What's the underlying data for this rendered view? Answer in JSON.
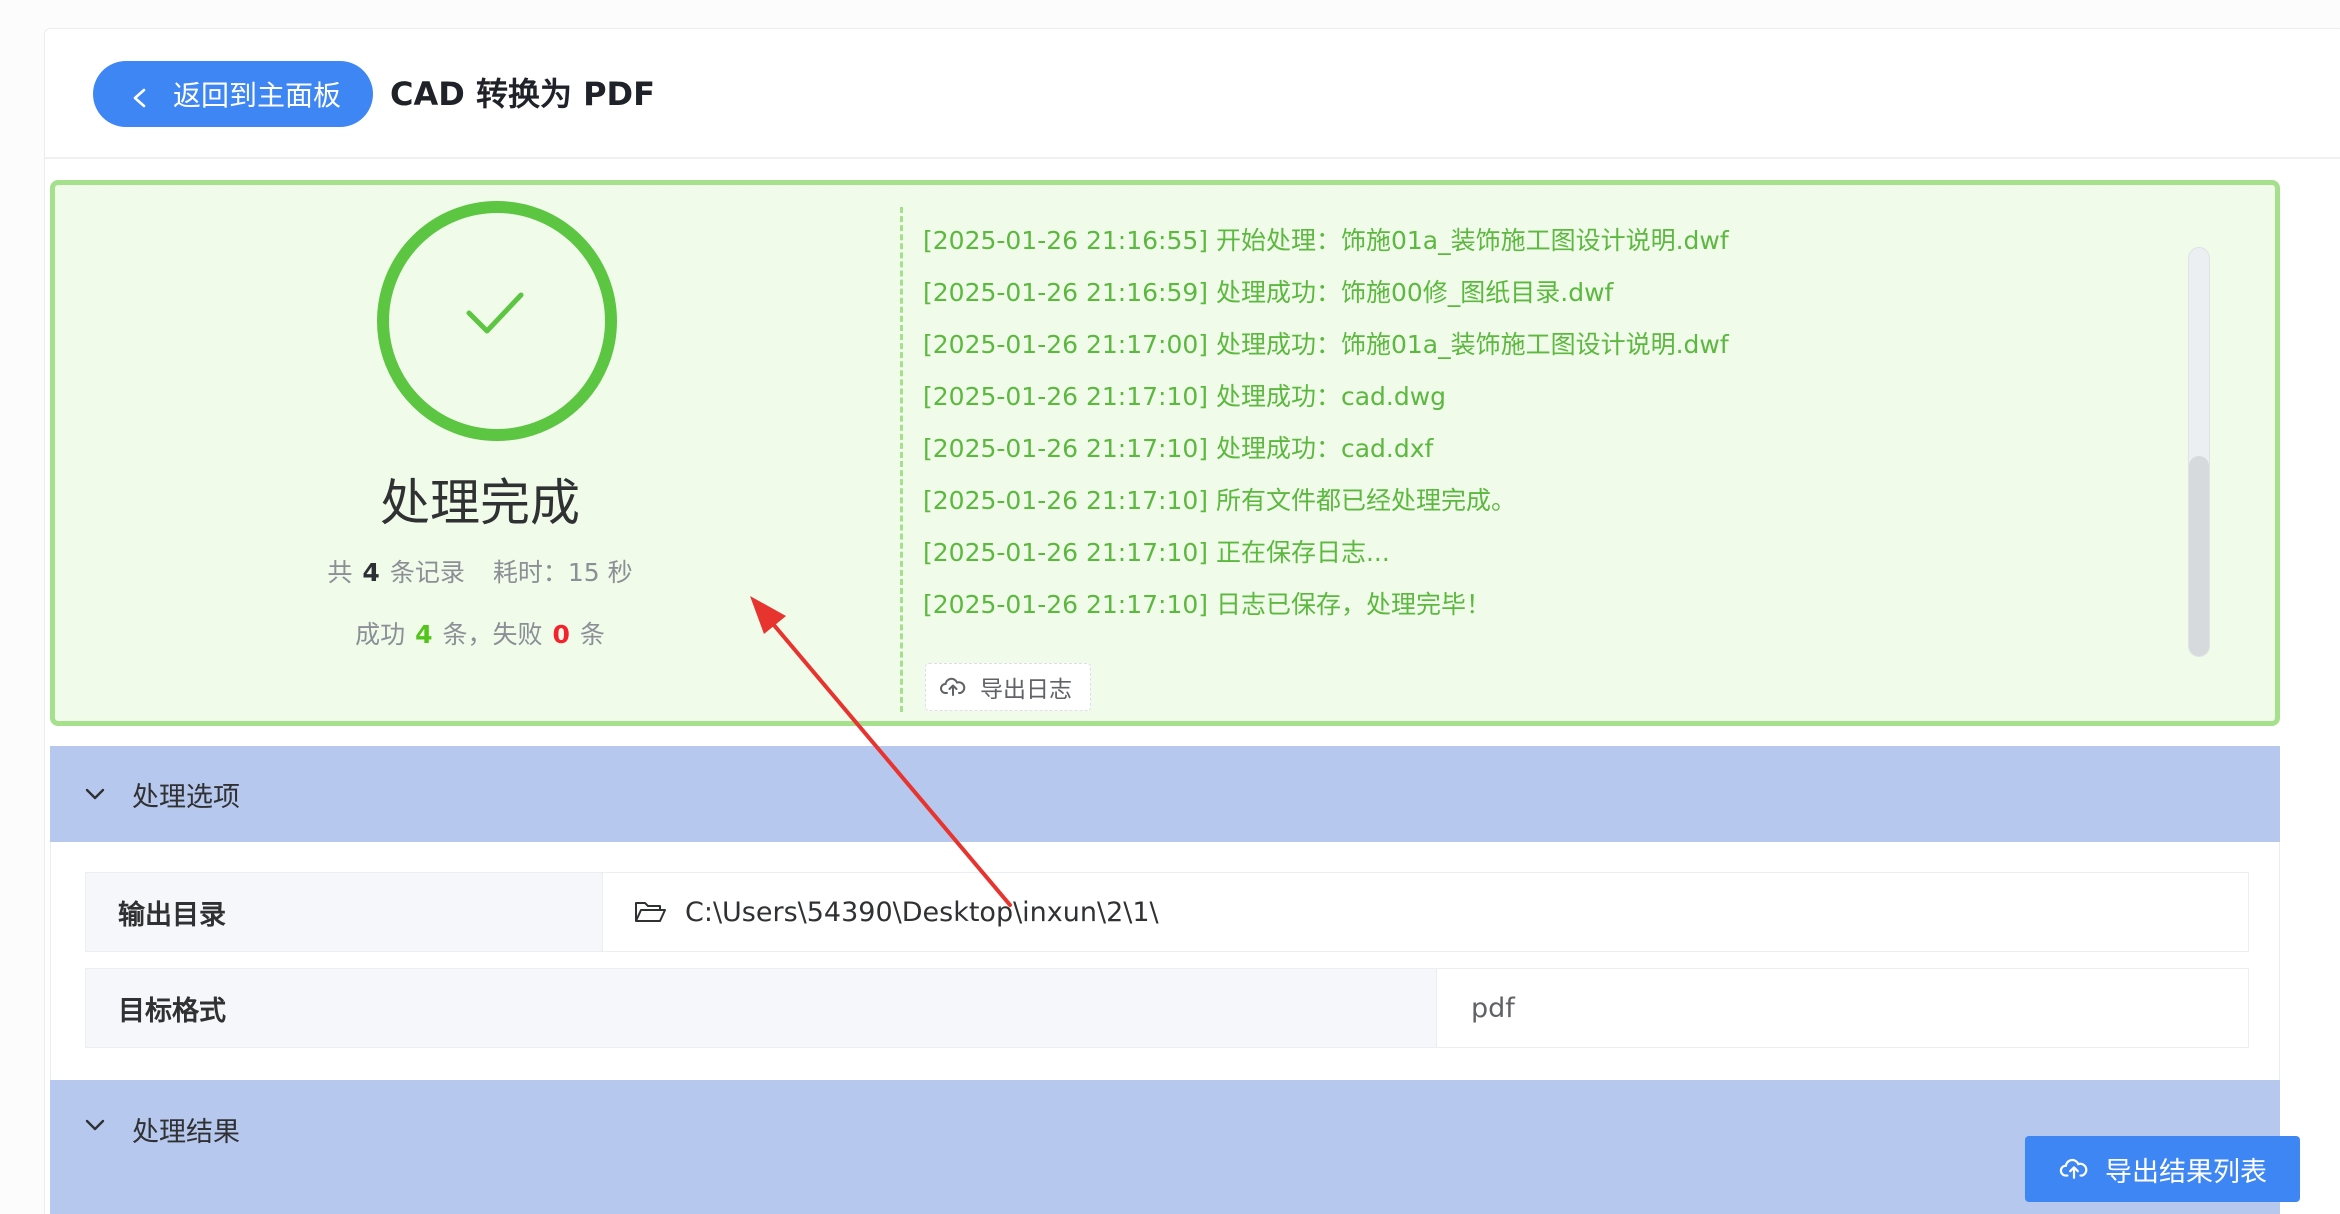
{
  "header": {
    "back_label": "返回到主面板",
    "title": "CAD 转换为 PDF"
  },
  "summary": {
    "status_title": "处理完成",
    "total_prefix": "共",
    "total_count": "4",
    "total_suffix": "条记录",
    "elapsed_label": "耗时：",
    "elapsed_value": "15 秒",
    "success_prefix": "成功",
    "success_count": "4",
    "success_suffix": "条，失败",
    "fail_count": "0",
    "fail_suffix": "条"
  },
  "log": {
    "lines": [
      "[2025-01-26 21:16:55] 开始处理：饰施01a_装饰施工图设计说明.dwf",
      "[2025-01-26 21:16:59] 处理成功：饰施00修_图纸目录.dwf",
      "[2025-01-26 21:17:00] 处理成功：饰施01a_装饰施工图设计说明.dwf",
      "[2025-01-26 21:17:10] 处理成功：cad.dwg",
      "[2025-01-26 21:17:10] 处理成功：cad.dxf",
      "[2025-01-26 21:17:10] 所有文件都已经处理完成。",
      "[2025-01-26 21:17:10] 正在保存日志...",
      "[2025-01-26 21:17:10] 日志已保存，处理完毕！"
    ],
    "export_label": "导出日志"
  },
  "options": {
    "section_title": "处理选项",
    "output_dir_label": "输出目录",
    "output_dir_value": "C:\\Users\\54390\\Desktop\\inxun\\2\\1\\",
    "target_format_label": "目标格式",
    "target_format_value": "pdf"
  },
  "results": {
    "section_title": "处理结果",
    "export_list_label": "导出结果列表"
  },
  "colors": {
    "primary": "#3f86f5",
    "success": "#5cc541",
    "panel_bg": "#f0fbea",
    "section_bg": "#b7c8ef",
    "danger": "#f5222d",
    "annotation": "#e8342f"
  }
}
